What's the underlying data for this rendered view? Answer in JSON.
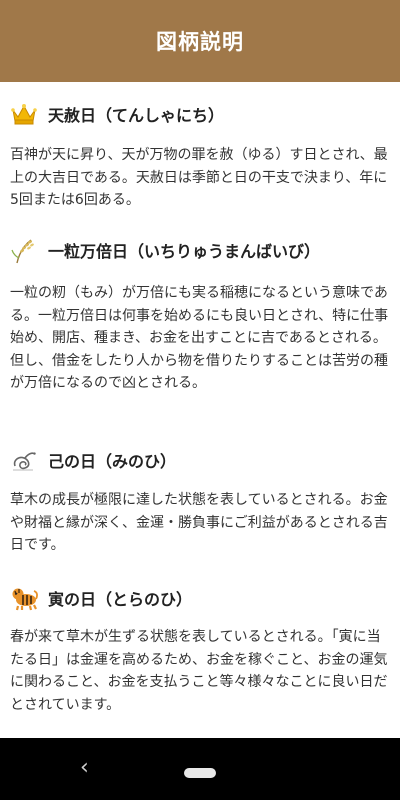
{
  "header": {
    "title": "図柄説明"
  },
  "sections": [
    {
      "icon": "crown-icon",
      "title": "天赦日（てんしゃにち）",
      "body": "百神が天に昇り、天が万物の罪を赦（ゆる）す日とされ、最上の大吉日である。天赦日は季節と日の干支で決まり、年に5回または6回ある。"
    },
    {
      "icon": "rice-plant-icon",
      "title": "一粒万倍日（いちりゅうまんばいび）",
      "body": "一粒の籾（もみ）が万倍にも実る稲穂になるという意味である。一粒万倍日は何事を始めるにも良い日とされ、特に仕事始め、開店、種まき、お金を出すことに吉であるとされる。但し、借金をしたり人から物を借りたりすることは苦労の種が万倍になるので凶とされる。"
    },
    {
      "icon": "snake-icon",
      "title": "己の日（みのひ）",
      "body": "草木の成長が極限に達した状態を表しているとされる。お金や財福と縁が深く、金運・勝負事にご利益があるとされる吉日です。"
    },
    {
      "icon": "tiger-icon",
      "title": "寅の日（とらのひ）",
      "body": "春が来て草木が生ずる状態を表しているとされる。「寅に当たる日」は金運を高めるため、お金を稼ぐこと、お金の運気に関わること、お金を支払うこと等々様々なことに良い日だとされています。"
    }
  ],
  "colors": {
    "header_bg": "#a07849",
    "header_text": "#ffffff",
    "navbar_bg": "#000000"
  },
  "navbar": {
    "back_icon": "back-triangle-icon",
    "home_icon": "home-pill-icon"
  }
}
